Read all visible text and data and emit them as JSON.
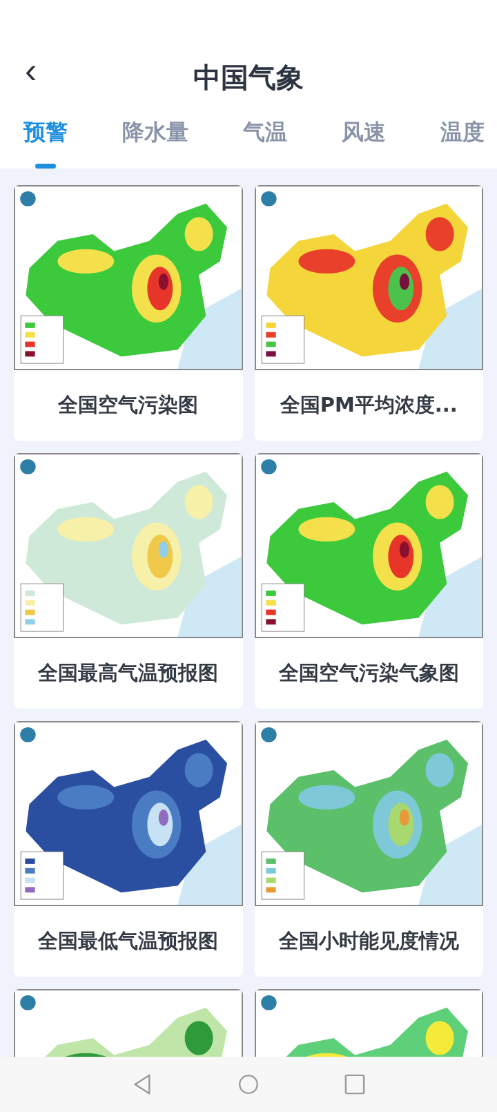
{
  "header": {
    "back_icon": "‹",
    "title": "中国气象"
  },
  "tabs": [
    {
      "label": "预警",
      "selected": true
    },
    {
      "label": "降水量",
      "selected": false
    },
    {
      "label": "气温",
      "selected": false
    },
    {
      "label": "风速",
      "selected": false
    },
    {
      "label": "温度",
      "selected": false
    }
  ],
  "cards": [
    {
      "kind": "picture",
      "title": "全国空气污染图"
    },
    {
      "kind": "picture",
      "title": "全国PM平均浓度..."
    },
    {
      "kind": "picture",
      "title": "全国最高气温预报图"
    },
    {
      "kind": "picture",
      "title": "全国空气污染气象图"
    },
    {
      "kind": "picture",
      "title": "全国最低气温预报图"
    },
    {
      "kind": "picture",
      "title": "全国小时能见度情况"
    },
    {
      "kind": "picture"
    },
    {
      "kind": "picture"
    }
  ]
}
